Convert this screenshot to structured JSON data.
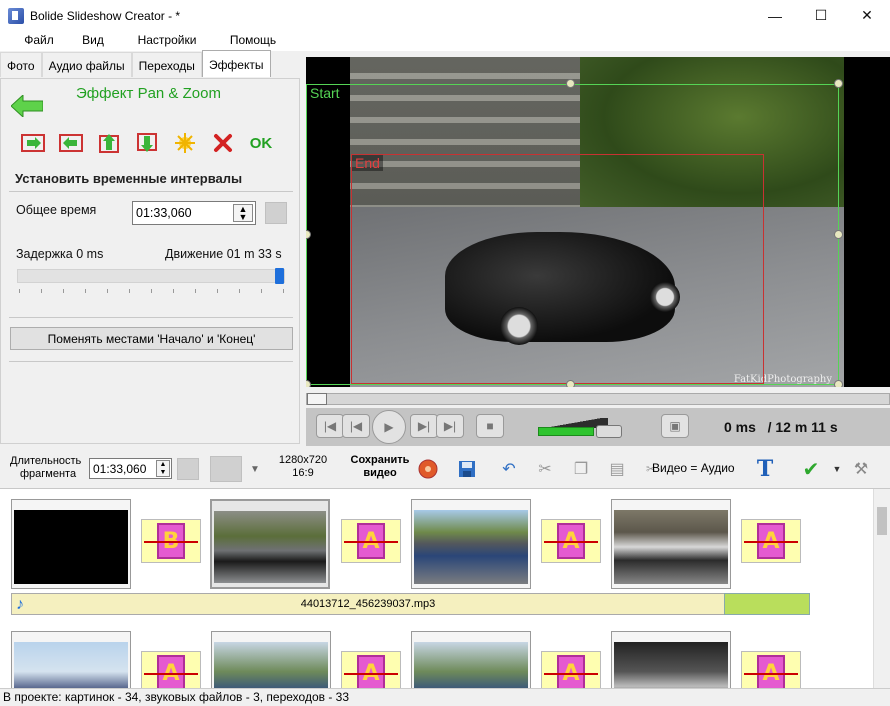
{
  "window": {
    "title": "Bolide Slideshow Creator - *"
  },
  "menu": [
    "Файл",
    "Вид",
    "Настройки",
    "Помощь"
  ],
  "tabs": [
    "Фото",
    "Аудио файлы",
    "Переходы",
    "Эффекты"
  ],
  "effect_panel": {
    "title": "Эффект Pan & Zoom",
    "ok_label": "OK",
    "section_title": "Установить временные интервалы",
    "total_time_label": "Общее время",
    "total_time_value": "01:33,060",
    "delay_label": "Задержка 0 ms",
    "motion_label": "Движение 01 m 33 s",
    "slider_fraction": 1.0,
    "swap_button": "Поменять местами 'Начало' и 'Конец'"
  },
  "preview": {
    "start_label": "Start",
    "end_label": "End",
    "watermark": "FatKidPhotography",
    "time_current": "0 ms",
    "time_total": "/ 12 m 11 s"
  },
  "timeline_toolbar": {
    "duration_label_line1": "Длительность",
    "duration_label_line2": "фрагмента",
    "duration_value": "01:33,060",
    "resolution_line1": "1280x720",
    "resolution_line2": "16:9",
    "save_line1": "Сохранить",
    "save_line2": "видео",
    "video_audio_label": "Видео = Аудио"
  },
  "storyboard": {
    "transitions_row1": [
      "B",
      "A",
      "A",
      "A"
    ],
    "transitions_row2": [
      "A",
      "A",
      "A",
      "A"
    ],
    "audio_file": "44013712_456239037.mp3"
  },
  "status": "В проекте: картинок - 34, звуковых файлов - 3, переходов - 33",
  "colors": {
    "accent_green": "#22a122",
    "start_frame": "#55d455",
    "end_frame": "#c83232",
    "transition_bg": "#fefeb0"
  }
}
